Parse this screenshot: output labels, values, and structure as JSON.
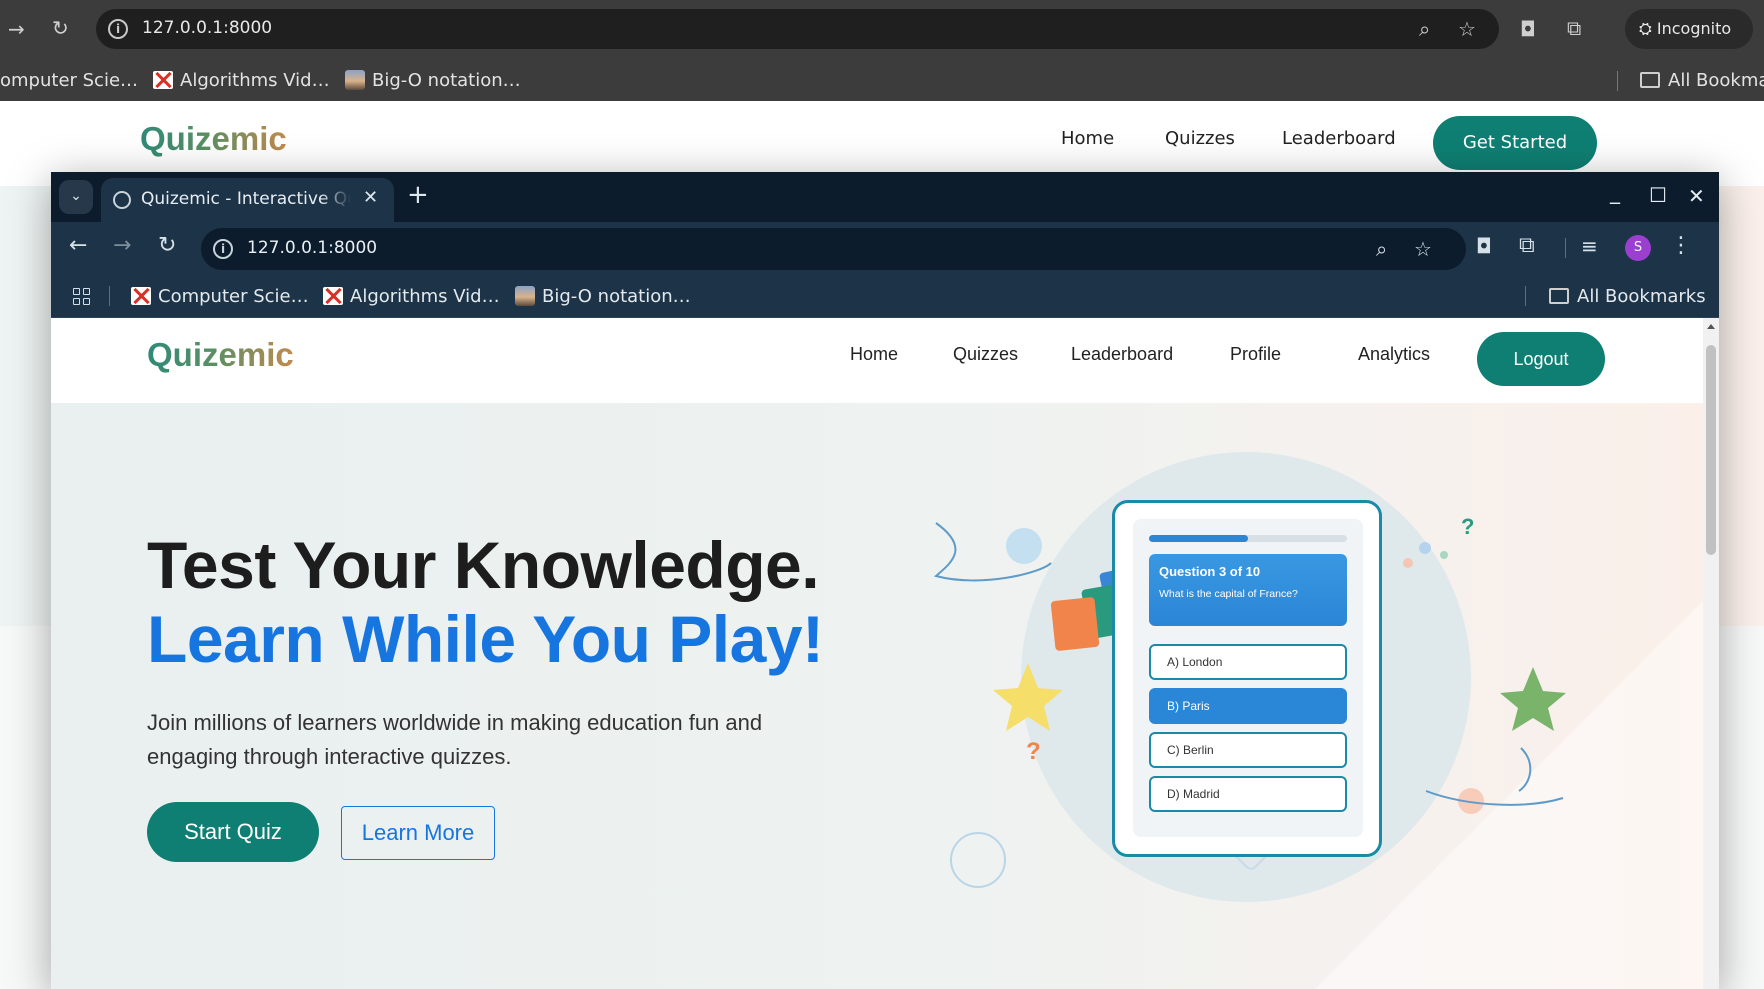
{
  "background_browser": {
    "url": "127.0.0.1:8000",
    "incognito_label": "Incognito",
    "bookmarks": [
      "omputer Scie…",
      "Algorithms Vid…",
      "Big-O notation…"
    ],
    "all_bookmarks": "All Bookma",
    "site": {
      "logo": "Quizemic",
      "nav": [
        "Home",
        "Quizzes",
        "Leaderboard"
      ],
      "cta": "Get Started"
    }
  },
  "window": {
    "tab_title": "Quizemic - Interactive Quiz Platform",
    "url": "127.0.0.1:8000",
    "profile_initial": "S",
    "bookmarks": [
      "Computer Scie…",
      "Algorithms Vid…",
      "Big-O notation…"
    ],
    "all_bookmarks": "All Bookmarks"
  },
  "site": {
    "logo": "Quizemic",
    "nav": {
      "home": "Home",
      "quizzes": "Quizzes",
      "leaderboard": "Leaderboard",
      "profile": "Profile",
      "analytics": "Analytics",
      "logout": "Logout"
    },
    "hero": {
      "headline_1": "Test Your Knowledge.",
      "headline_2": "Learn While You Play!",
      "lead": "Join millions of learners worldwide in making education fun and engaging through interactive quizzes.",
      "start_quiz": "Start Quiz",
      "learn_more": "Learn More"
    },
    "illustration": {
      "progress": 0.5,
      "question_number": "Question 3 of 10",
      "question": "What is the capital of France?",
      "options": [
        "A) London",
        "B) Paris",
        "C) Berlin",
        "D) Madrid"
      ],
      "selected_option": "B) Paris"
    }
  },
  "colors": {
    "brand_teal": "#0f7f73",
    "accent_blue": "#1775e0",
    "tab_dark": "#0c1c2c",
    "toolbar": "#1d3347"
  }
}
